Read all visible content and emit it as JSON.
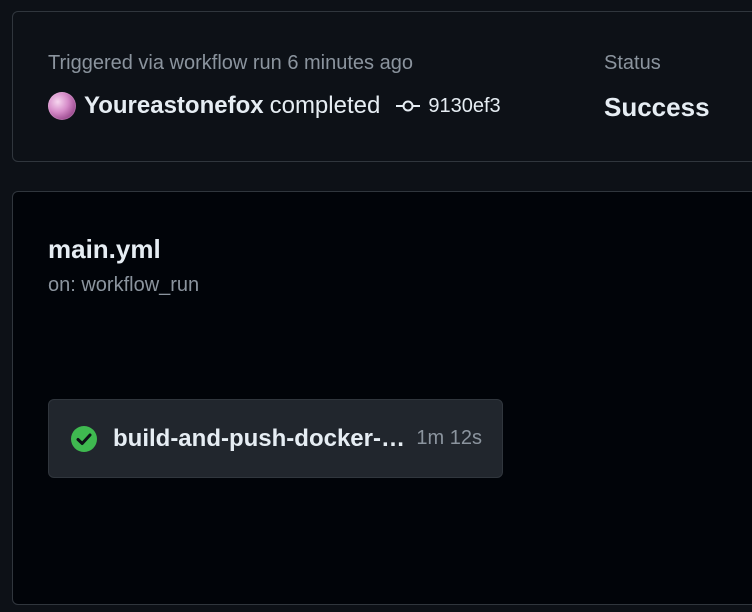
{
  "summary": {
    "trigger_text": "Triggered via workflow run 6 minutes ago",
    "actor": "Youreastonefox",
    "action": "completed",
    "commit_icon": "git-commit-icon",
    "commit_sha": "9130ef3",
    "status_label": "Status",
    "status_value": "Success"
  },
  "workflow": {
    "file_name": "main.yml",
    "trigger": "on: workflow_run"
  },
  "jobs": [
    {
      "name": "build-and-push-docker-i...",
      "duration": "1m 12s",
      "status_icon": "check-circle-icon",
      "status_color": "#3fb950"
    }
  ]
}
